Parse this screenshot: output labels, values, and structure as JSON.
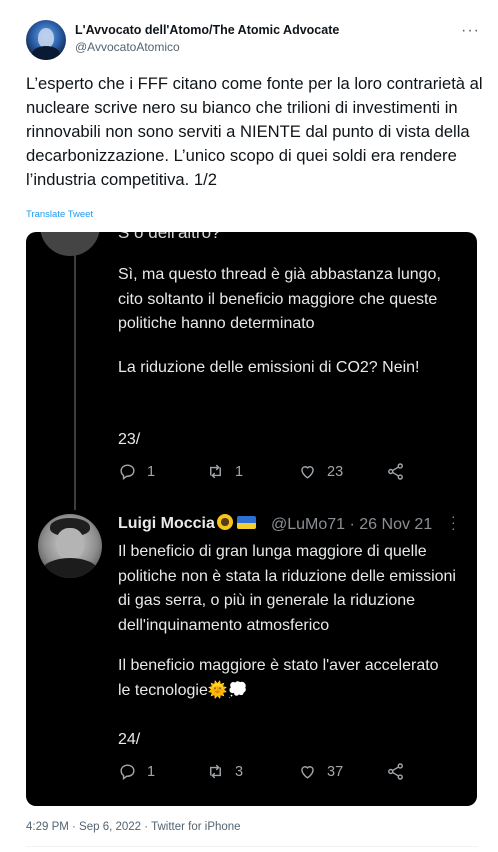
{
  "author": {
    "name": "L'Avvocato dell'Atomo/The Atomic Advocate",
    "handle": "@AvvocatoAtomico"
  },
  "tweet": {
    "text": "L’esperto che i FFF citano come fonte per la loro contrarietà al nucleare scrive nero su bianco che trilioni di investimenti in rinnovabili non sono serviti a NIENTE dal punto di vista della decarbonizzazione. L’unico scopo di quei soldi era rendere l’industria competitiva. 1/2",
    "translate_label": "Translate Tweet",
    "timestamp": "4:29 PM · Sep 6, 2022 · Twitter for iPhone"
  },
  "screenshot": {
    "top_snippet": "S o dell'altro?",
    "post1": {
      "para1": "Sì, ma questo thread è già abbastanza lungo, cito soltanto il beneficio maggiore che queste politiche hanno determinato",
      "para2": "La riduzione delle emissioni di CO2? Nein!",
      "number": "23/",
      "replies": "1",
      "retweets": "1",
      "likes": "23"
    },
    "post2": {
      "author_name": "Luigi Moccia",
      "meta": "@LuMo71 · 26 Nov 21",
      "para1": "Il beneficio di gran lunga maggiore di quelle politiche non è stata la riduzione delle emissioni di gas serra, o più in generale la riduzione dell'inquinamento atmosferico",
      "para2": "Il beneficio maggiore è stato l'aver accelerato le tecnologie🌞💭",
      "number": "24/",
      "replies": "1",
      "retweets": "3",
      "likes": "37"
    }
  }
}
